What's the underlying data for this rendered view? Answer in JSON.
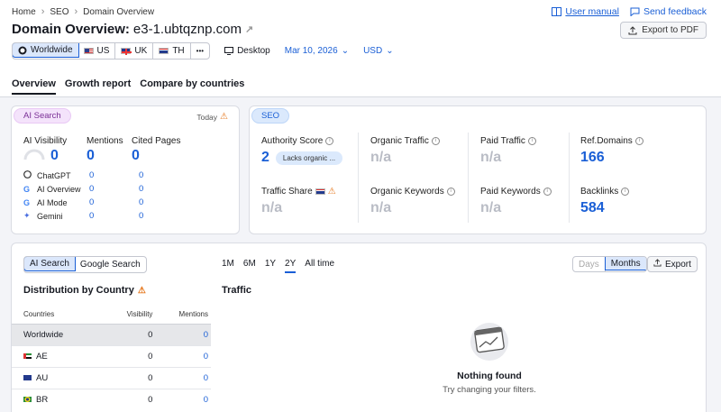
{
  "breadcrumb": [
    "Home",
    "SEO",
    "Domain Overview"
  ],
  "links": {
    "user_manual": "User manual",
    "send_feedback": "Send feedback"
  },
  "header": {
    "title_prefix": "Domain Overview:",
    "domain": "e3-1.ubtqznp.com",
    "export_pdf": "Export to PDF"
  },
  "filters": {
    "regions": [
      "Worldwide",
      "US",
      "UK",
      "TH"
    ],
    "more": "•••",
    "device": "Desktop",
    "date": "Mar 10, 2026",
    "currency": "USD"
  },
  "tabs": [
    "Overview",
    "Growth report",
    "Compare by countries"
  ],
  "ai_card": {
    "pill": "AI Search",
    "today": "Today",
    "metrics": [
      {
        "label": "AI Visibility",
        "value": "0"
      },
      {
        "label": "Mentions",
        "value": "0"
      },
      {
        "label": "Cited Pages",
        "value": "0"
      }
    ],
    "rows": [
      {
        "name": "ChatGPT",
        "icon": "chatgpt-icon",
        "mentions": "0",
        "cited": "0"
      },
      {
        "name": "AI Overview",
        "icon": "google-icon",
        "mentions": "0",
        "cited": "0"
      },
      {
        "name": "AI Mode",
        "icon": "google-icon",
        "mentions": "0",
        "cited": "0"
      },
      {
        "name": "Gemini",
        "icon": "gemini-icon",
        "mentions": "0",
        "cited": "0"
      }
    ]
  },
  "seo_card": {
    "pill": "SEO",
    "metrics": [
      {
        "label": "Authority Score",
        "value": "2",
        "badge": "Lacks organic ..."
      },
      {
        "label": "Organic Traffic",
        "value": "n/a"
      },
      {
        "label": "Paid Traffic",
        "value": "n/a"
      },
      {
        "label": "Ref.Domains",
        "value": "166"
      },
      {
        "label": "Traffic Share",
        "value": "n/a"
      },
      {
        "label": "Organic Keywords",
        "value": "n/a"
      },
      {
        "label": "Paid Keywords",
        "value": "n/a"
      },
      {
        "label": "Backlinks",
        "value": "584"
      }
    ]
  },
  "bottom": {
    "toggle": [
      "AI Search",
      "Google Search"
    ],
    "ranges": [
      "1M",
      "6M",
      "1Y",
      "2Y",
      "All time"
    ],
    "period": [
      "Days",
      "Months"
    ],
    "export": "Export",
    "dist_title": "Distribution by Country",
    "traffic_title": "Traffic",
    "table_headers": [
      "Countries",
      "Visibility",
      "Mentions"
    ],
    "table_rows": [
      {
        "country": "Worldwide",
        "visibility": "0",
        "mentions": "0"
      },
      {
        "country": "AE",
        "visibility": "0",
        "mentions": "0"
      },
      {
        "country": "AU",
        "visibility": "0",
        "mentions": "0"
      },
      {
        "country": "BR",
        "visibility": "0",
        "mentions": "0"
      }
    ],
    "empty_title": "Nothing found",
    "empty_sub": "Try changing your filters."
  },
  "colors": {
    "accent": "#1a5fd6",
    "ai_pill": "#f4e3fb",
    "seo_pill": "#dbe9fc",
    "warning": "#e6781e"
  }
}
